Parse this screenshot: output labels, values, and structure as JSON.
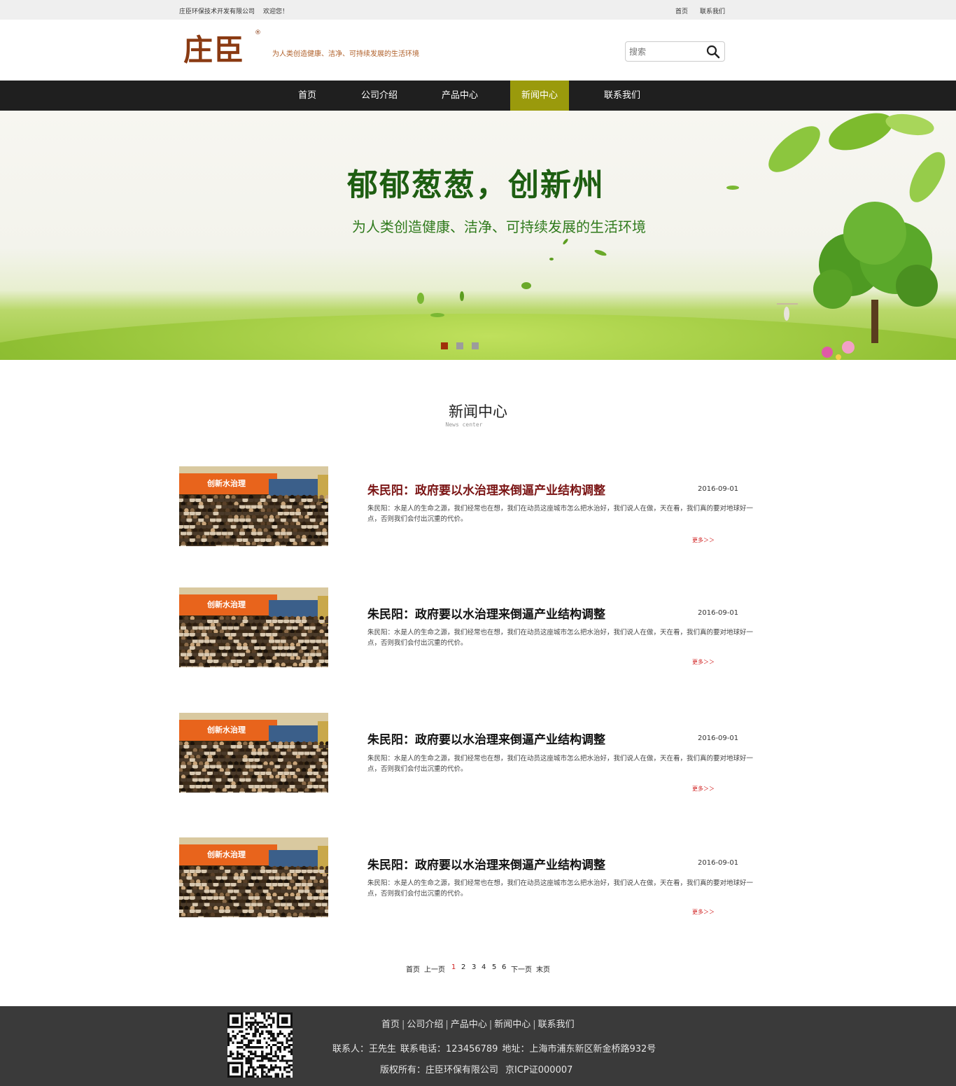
{
  "topbar": {
    "company": "庄臣环保技术开发有限公司",
    "welcome": "欢迎您！",
    "links": [
      "首页",
      "联系我们"
    ]
  },
  "header": {
    "logo_text": "庄臣",
    "logo_reg": "®",
    "slogan": "为人类创造健康、洁净、可持续发展的生活环境",
    "search_placeholder": "搜索"
  },
  "nav": {
    "items": [
      "首页",
      "公司介绍",
      "产品中心",
      "新闻中心",
      "联系我们"
    ],
    "active_index": 3,
    "active_color": "#9a9a0c"
  },
  "banner": {
    "headline": "郁郁葱葱，创新州",
    "subline": "为人类创造健康、洁净、可持续发展的生活环境",
    "slide_count": 3,
    "active_slide": 0,
    "active_dot_color": "#a0300a",
    "dot_color": "#9c9c9c"
  },
  "section": {
    "title": "新闻中心",
    "subtitle": "News center"
  },
  "news": [
    {
      "title": "朱民阳：政府要以水治理来倒逼产业结构调整",
      "date": "2016-09-01",
      "summary": "朱民阳：水是人的生命之源，我们经常也在想，我们在动员这座城市怎么把水治好，我们说人在做，天在看，我们真的要对地球好一点，否则我们会付出沉重的代价。",
      "more": "更多＞＞",
      "thumb_banner": "创新水治理"
    },
    {
      "title": "朱民阳：政府要以水治理来倒逼产业结构调整",
      "date": "2016-09-01",
      "summary": "朱民阳：水是人的生命之源，我们经常也在想，我们在动员这座城市怎么把水治好，我们说人在做，天在看，我们真的要对地球好一点，否则我们会付出沉重的代价。",
      "more": "更多＞＞",
      "thumb_banner": "创新水治理"
    },
    {
      "title": "朱民阳：政府要以水治理来倒逼产业结构调整",
      "date": "2016-09-01",
      "summary": "朱民阳：水是人的生命之源，我们经常也在想，我们在动员这座城市怎么把水治好，我们说人在做，天在看，我们真的要对地球好一点，否则我们会付出沉重的代价。",
      "more": "更多＞＞",
      "thumb_banner": "创新水治理"
    },
    {
      "title": "朱民阳：政府要以水治理来倒逼产业结构调整",
      "date": "2016-09-01",
      "summary": "朱民阳：水是人的生命之源，我们经常也在想，我们在动员这座城市怎么把水治好，我们说人在做，天在看，我们真的要对地球好一点，否则我们会付出沉重的代价。",
      "more": "更多＞＞",
      "thumb_banner": "创新水治理"
    }
  ],
  "pagination": {
    "first": "首页",
    "prev": "上一页",
    "pages": [
      "1",
      "2",
      "3",
      "4",
      "5",
      "6"
    ],
    "current": "1",
    "next": "下一页",
    "last": "末页"
  },
  "footer": {
    "links": [
      "首页",
      "公司介绍",
      "产品中心",
      "新闻中心",
      "联系我们"
    ],
    "separator": "|",
    "contact_person": "联系人：王先生",
    "phone": "联系电话：123456789",
    "address": "地址：上海市浦东新区新金桥路932号",
    "copyright": "版权所有：庄臣环保有限公司",
    "icp": "京ICP证000007"
  }
}
